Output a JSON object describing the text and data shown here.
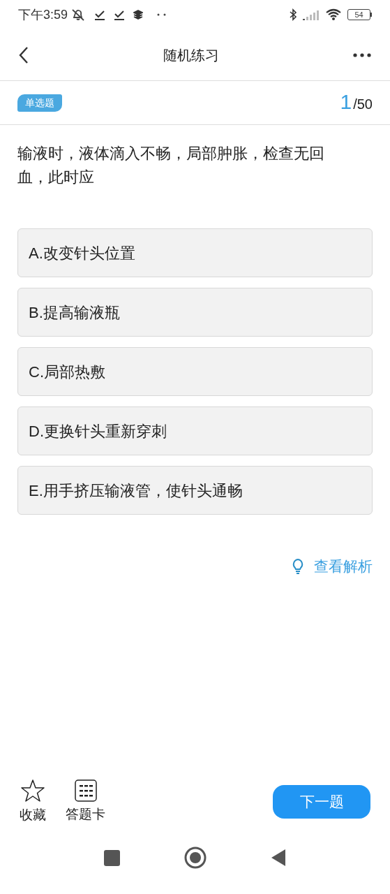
{
  "status_bar": {
    "time": "下午3:59",
    "battery": "54"
  },
  "header": {
    "title": "随机练习"
  },
  "question": {
    "type_tag": "单选题",
    "current": "1",
    "total": "/50",
    "text": "输液时，液体滴入不畅，局部肿胀，检查无回血，此时应",
    "options": [
      {
        "label": "A.改变针头位置",
        "selected": false
      },
      {
        "label": "B.提高输液瓶",
        "selected": false
      },
      {
        "label": "C.局部热敷",
        "selected": false
      },
      {
        "label": "D.更换针头重新穿刺",
        "selected": false
      },
      {
        "label": "E.用手挤压输液管，使针头通畅",
        "selected": false
      }
    ]
  },
  "analysis_link": "查看解析",
  "bottom_bar": {
    "favorite": "收藏",
    "answer_card": "答题卡",
    "next": "下一题"
  }
}
